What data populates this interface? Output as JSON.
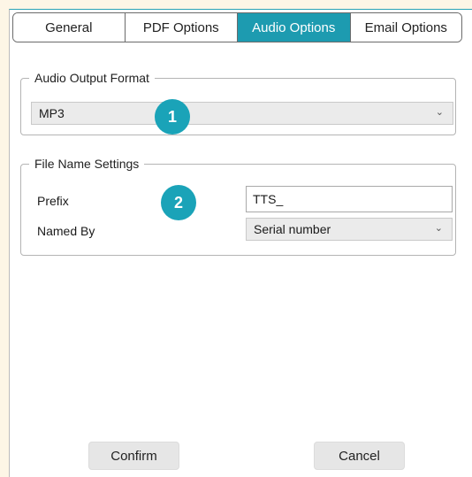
{
  "tabs": [
    {
      "label": "General",
      "active": false
    },
    {
      "label": "PDF Options",
      "active": false
    },
    {
      "label": "Audio Options",
      "active": true
    },
    {
      "label": "Email Options",
      "active": false
    }
  ],
  "audio_output": {
    "legend": "Audio Output Format",
    "format_value": "MP3"
  },
  "file_name": {
    "legend": "File Name Settings",
    "prefix_label": "Prefix",
    "prefix_value": "TTS_",
    "named_by_label": "Named By",
    "named_by_value": "Serial number"
  },
  "badges": {
    "one": "1",
    "two": "2"
  },
  "buttons": {
    "confirm": "Confirm",
    "cancel": "Cancel"
  },
  "colors": {
    "accent": "#1d9bb0",
    "badge": "#1aa3b8",
    "background": "#fdf6e6"
  },
  "icons": {
    "dropdown": "chevron-down-icon"
  }
}
